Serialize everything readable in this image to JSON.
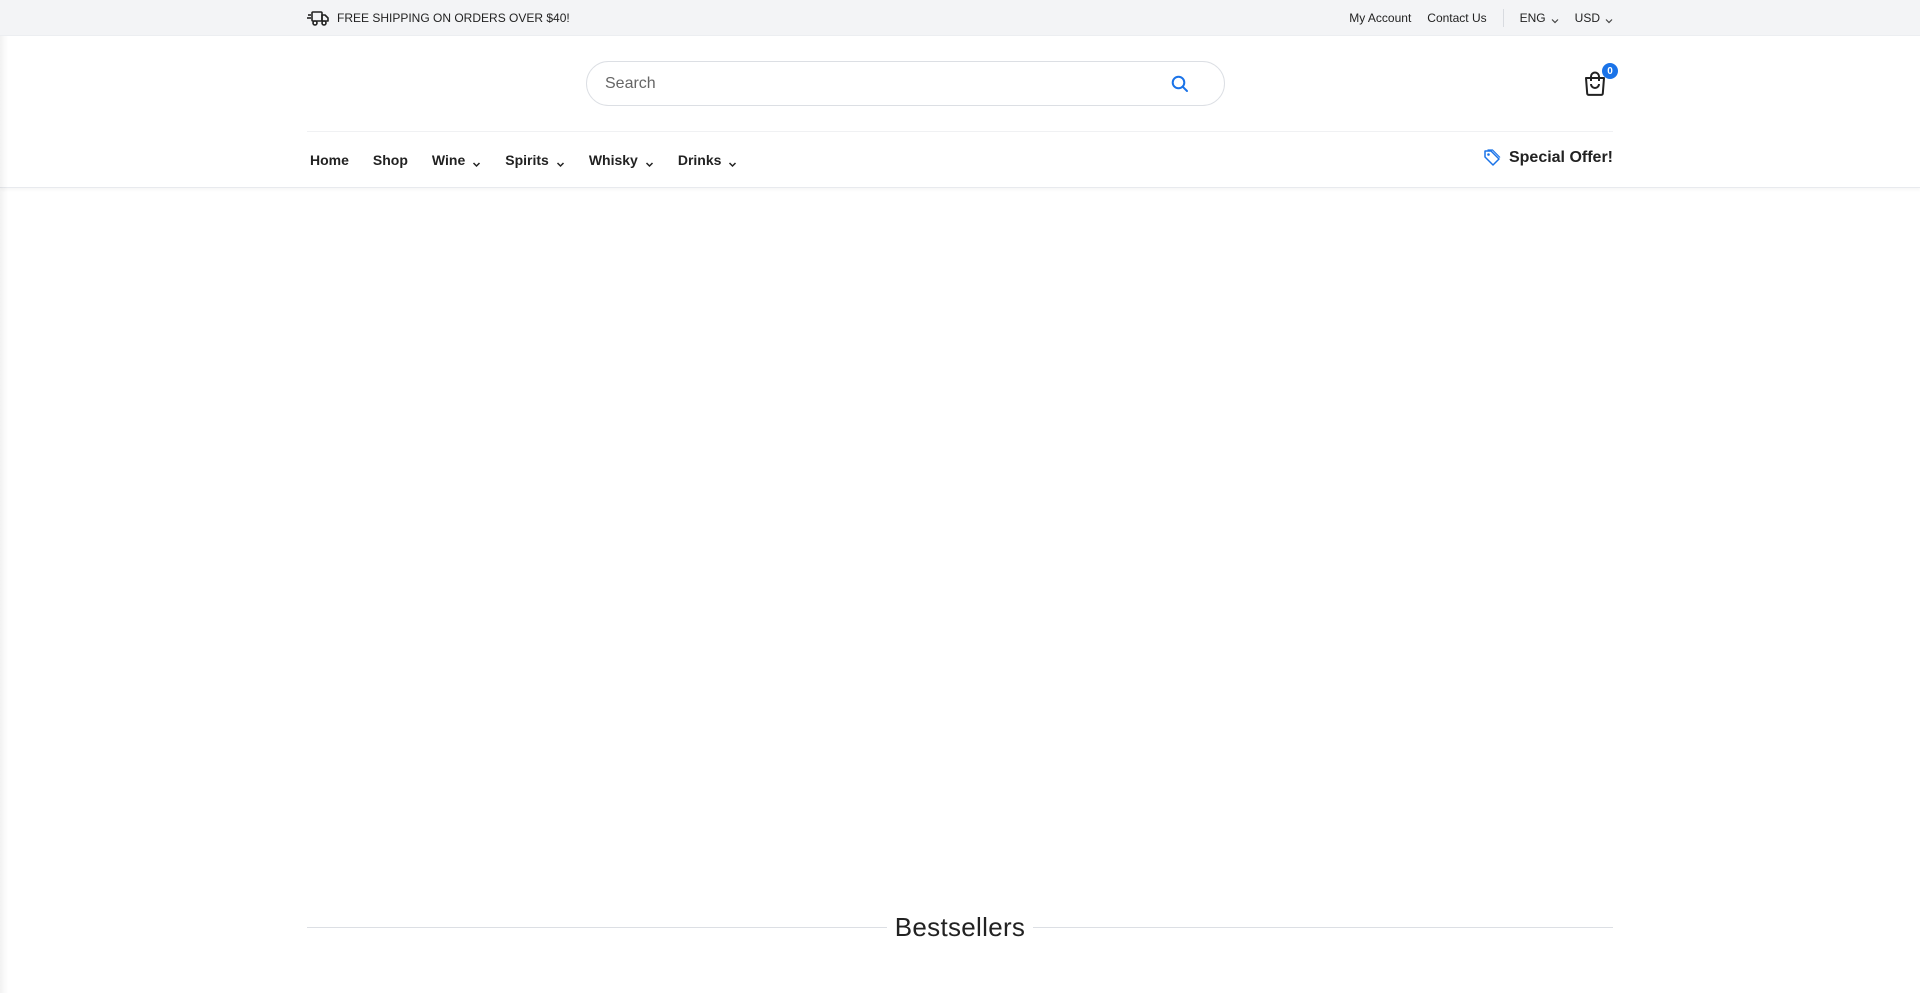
{
  "topbar": {
    "shipping_text": "FREE SHIPPING ON ORDERS OVER $40!",
    "shipping_icon": "truck-icon",
    "my_account": "My Account",
    "contact_us": "Contact Us",
    "language": "ENG",
    "currency": "USD"
  },
  "header": {
    "search_placeholder": "Search",
    "search_icon": "search-icon",
    "cart_icon": "shopping-bag-icon",
    "cart_count": "0",
    "accent_color": "#1a73e8"
  },
  "nav": {
    "items": [
      {
        "label": "Home",
        "has_dropdown": false
      },
      {
        "label": "Shop",
        "has_dropdown": false
      },
      {
        "label": "Wine",
        "has_dropdown": true
      },
      {
        "label": "Spirits",
        "has_dropdown": true
      },
      {
        "label": "Whisky",
        "has_dropdown": true
      },
      {
        "label": "Drinks",
        "has_dropdown": true
      }
    ],
    "special_offer": "Special Offer!",
    "special_icon": "tag-icon"
  },
  "main": {
    "section_title": "Bestsellers"
  }
}
